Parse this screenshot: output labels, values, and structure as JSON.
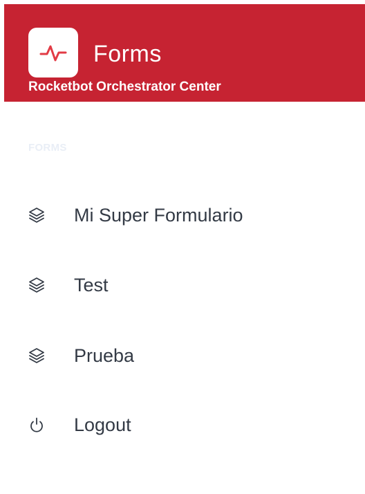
{
  "header": {
    "title": "Forms",
    "subtitle": "Rocketbot Orchestrator Center",
    "logo_icon": "pulse-icon",
    "background_color": "#c62332"
  },
  "sidebar": {
    "section_heading": "FORMS",
    "items": [
      {
        "label": "Mi Super Formulario",
        "icon": "layers-icon"
      },
      {
        "label": "Test",
        "icon": "layers-icon"
      },
      {
        "label": "Prueba",
        "icon": "layers-icon"
      },
      {
        "label": "Logout",
        "icon": "power-icon"
      }
    ]
  }
}
